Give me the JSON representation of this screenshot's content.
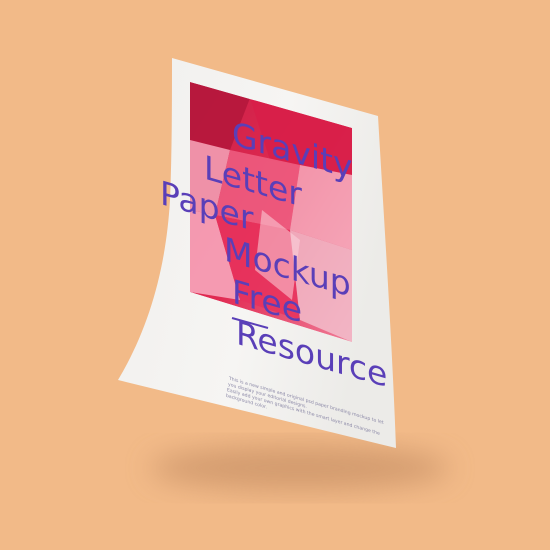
{
  "poster": {
    "title_lines": [
      "Gravity",
      "Letter",
      "Paper",
      "Mockup",
      "Free",
      "Resource"
    ],
    "body_lines": [
      "This is a new simple and original psd paper branding mockup to let",
      "you display your editorial designs.",
      "Easily add your own graphics with the smart layer and change the",
      "background color."
    ]
  },
  "colors": {
    "background": "#f2ba88",
    "paper": "#f4f3f1",
    "title": "#5a3fb8",
    "art_primary": "#e0244f",
    "art_light": "#f08aa4"
  }
}
